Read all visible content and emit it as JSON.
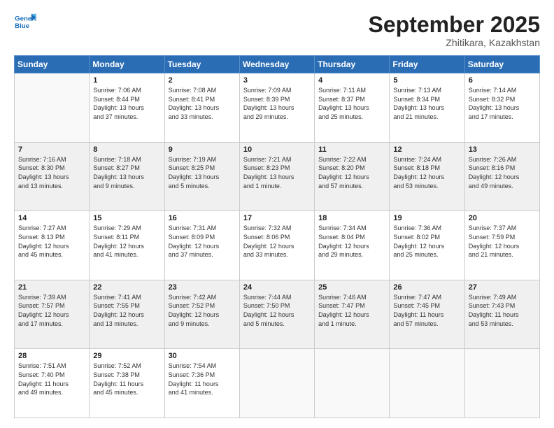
{
  "logo": {
    "line1": "General",
    "line2": "Blue"
  },
  "title": "September 2025",
  "subtitle": "Zhitikara, Kazakhstan",
  "header_days": [
    "Sunday",
    "Monday",
    "Tuesday",
    "Wednesday",
    "Thursday",
    "Friday",
    "Saturday"
  ],
  "weeks": [
    {
      "shaded": false,
      "days": [
        {
          "num": "",
          "info": ""
        },
        {
          "num": "1",
          "info": "Sunrise: 7:06 AM\nSunset: 8:44 PM\nDaylight: 13 hours\nand 37 minutes."
        },
        {
          "num": "2",
          "info": "Sunrise: 7:08 AM\nSunset: 8:41 PM\nDaylight: 13 hours\nand 33 minutes."
        },
        {
          "num": "3",
          "info": "Sunrise: 7:09 AM\nSunset: 8:39 PM\nDaylight: 13 hours\nand 29 minutes."
        },
        {
          "num": "4",
          "info": "Sunrise: 7:11 AM\nSunset: 8:37 PM\nDaylight: 13 hours\nand 25 minutes."
        },
        {
          "num": "5",
          "info": "Sunrise: 7:13 AM\nSunset: 8:34 PM\nDaylight: 13 hours\nand 21 minutes."
        },
        {
          "num": "6",
          "info": "Sunrise: 7:14 AM\nSunset: 8:32 PM\nDaylight: 13 hours\nand 17 minutes."
        }
      ]
    },
    {
      "shaded": true,
      "days": [
        {
          "num": "7",
          "info": "Sunrise: 7:16 AM\nSunset: 8:30 PM\nDaylight: 13 hours\nand 13 minutes."
        },
        {
          "num": "8",
          "info": "Sunrise: 7:18 AM\nSunset: 8:27 PM\nDaylight: 13 hours\nand 9 minutes."
        },
        {
          "num": "9",
          "info": "Sunrise: 7:19 AM\nSunset: 8:25 PM\nDaylight: 13 hours\nand 5 minutes."
        },
        {
          "num": "10",
          "info": "Sunrise: 7:21 AM\nSunset: 8:23 PM\nDaylight: 13 hours\nand 1 minute."
        },
        {
          "num": "11",
          "info": "Sunrise: 7:22 AM\nSunset: 8:20 PM\nDaylight: 12 hours\nand 57 minutes."
        },
        {
          "num": "12",
          "info": "Sunrise: 7:24 AM\nSunset: 8:18 PM\nDaylight: 12 hours\nand 53 minutes."
        },
        {
          "num": "13",
          "info": "Sunrise: 7:26 AM\nSunset: 8:16 PM\nDaylight: 12 hours\nand 49 minutes."
        }
      ]
    },
    {
      "shaded": false,
      "days": [
        {
          "num": "14",
          "info": "Sunrise: 7:27 AM\nSunset: 8:13 PM\nDaylight: 12 hours\nand 45 minutes."
        },
        {
          "num": "15",
          "info": "Sunrise: 7:29 AM\nSunset: 8:11 PM\nDaylight: 12 hours\nand 41 minutes."
        },
        {
          "num": "16",
          "info": "Sunrise: 7:31 AM\nSunset: 8:09 PM\nDaylight: 12 hours\nand 37 minutes."
        },
        {
          "num": "17",
          "info": "Sunrise: 7:32 AM\nSunset: 8:06 PM\nDaylight: 12 hours\nand 33 minutes."
        },
        {
          "num": "18",
          "info": "Sunrise: 7:34 AM\nSunset: 8:04 PM\nDaylight: 12 hours\nand 29 minutes."
        },
        {
          "num": "19",
          "info": "Sunrise: 7:36 AM\nSunset: 8:02 PM\nDaylight: 12 hours\nand 25 minutes."
        },
        {
          "num": "20",
          "info": "Sunrise: 7:37 AM\nSunset: 7:59 PM\nDaylight: 12 hours\nand 21 minutes."
        }
      ]
    },
    {
      "shaded": true,
      "days": [
        {
          "num": "21",
          "info": "Sunrise: 7:39 AM\nSunset: 7:57 PM\nDaylight: 12 hours\nand 17 minutes."
        },
        {
          "num": "22",
          "info": "Sunrise: 7:41 AM\nSunset: 7:55 PM\nDaylight: 12 hours\nand 13 minutes."
        },
        {
          "num": "23",
          "info": "Sunrise: 7:42 AM\nSunset: 7:52 PM\nDaylight: 12 hours\nand 9 minutes."
        },
        {
          "num": "24",
          "info": "Sunrise: 7:44 AM\nSunset: 7:50 PM\nDaylight: 12 hours\nand 5 minutes."
        },
        {
          "num": "25",
          "info": "Sunrise: 7:46 AM\nSunset: 7:47 PM\nDaylight: 12 hours\nand 1 minute."
        },
        {
          "num": "26",
          "info": "Sunrise: 7:47 AM\nSunset: 7:45 PM\nDaylight: 11 hours\nand 57 minutes."
        },
        {
          "num": "27",
          "info": "Sunrise: 7:49 AM\nSunset: 7:43 PM\nDaylight: 11 hours\nand 53 minutes."
        }
      ]
    },
    {
      "shaded": false,
      "days": [
        {
          "num": "28",
          "info": "Sunrise: 7:51 AM\nSunset: 7:40 PM\nDaylight: 11 hours\nand 49 minutes."
        },
        {
          "num": "29",
          "info": "Sunrise: 7:52 AM\nSunset: 7:38 PM\nDaylight: 11 hours\nand 45 minutes."
        },
        {
          "num": "30",
          "info": "Sunrise: 7:54 AM\nSunset: 7:36 PM\nDaylight: 11 hours\nand 41 minutes."
        },
        {
          "num": "",
          "info": ""
        },
        {
          "num": "",
          "info": ""
        },
        {
          "num": "",
          "info": ""
        },
        {
          "num": "",
          "info": ""
        }
      ]
    }
  ]
}
